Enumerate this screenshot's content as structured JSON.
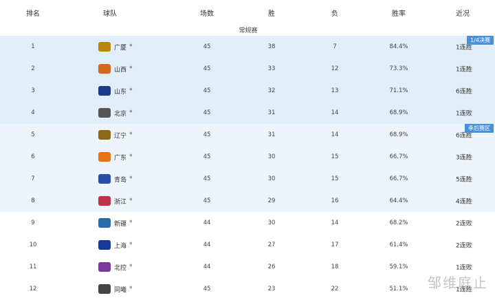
{
  "header": {
    "rank": "排名",
    "team": "球队",
    "games": "场数",
    "wins": "胜",
    "losses": "负",
    "pct": "胜率",
    "recent": "近况"
  },
  "section_label": "常规赛",
  "zone_labels": {
    "quarterfinal": "1/4决赛",
    "playoff": "季后赛区"
  },
  "watermark": "邹维庭止",
  "rows": [
    {
      "rank": "1",
      "team": "广厦",
      "star": "*",
      "games": "45",
      "wins": "38",
      "losses": "7",
      "pct": "84.4%",
      "recent": "1连胜",
      "logo_color": "#b8860b"
    },
    {
      "rank": "2",
      "team": "山西",
      "star": "*",
      "games": "45",
      "wins": "33",
      "losses": "12",
      "pct": "73.3%",
      "recent": "1连胜",
      "logo_color": "#d2691e"
    },
    {
      "rank": "3",
      "team": "山东",
      "star": "*",
      "games": "45",
      "wins": "32",
      "losses": "13",
      "pct": "71.1%",
      "recent": "6连胜",
      "logo_color": "#1e3a8a"
    },
    {
      "rank": "4",
      "team": "北京",
      "star": "*",
      "games": "45",
      "wins": "31",
      "losses": "14",
      "pct": "68.9%",
      "recent": "1连败",
      "logo_color": "#555555"
    },
    {
      "rank": "5",
      "team": "辽宁",
      "star": "*",
      "games": "45",
      "wins": "31",
      "losses": "14",
      "pct": "68.9%",
      "recent": "6连胜",
      "logo_color": "#8b6914"
    },
    {
      "rank": "6",
      "team": "广东",
      "star": "*",
      "games": "45",
      "wins": "30",
      "losses": "15",
      "pct": "66.7%",
      "recent": "3连胜",
      "logo_color": "#e8741a"
    },
    {
      "rank": "7",
      "team": "青岛",
      "star": "*",
      "games": "45",
      "wins": "30",
      "losses": "15",
      "pct": "66.7%",
      "recent": "5连胜",
      "logo_color": "#2850a8"
    },
    {
      "rank": "8",
      "team": "浙江",
      "star": "*",
      "games": "45",
      "wins": "29",
      "losses": "16",
      "pct": "64.4%",
      "recent": "4连胜",
      "logo_color": "#c0304a"
    },
    {
      "rank": "9",
      "team": "新疆",
      "star": "*",
      "games": "44",
      "wins": "30",
      "losses": "14",
      "pct": "68.2%",
      "recent": "2连败",
      "logo_color": "#2a6aa8"
    },
    {
      "rank": "10",
      "team": "上海",
      "star": "*",
      "games": "44",
      "wins": "27",
      "losses": "17",
      "pct": "61.4%",
      "recent": "2连败",
      "logo_color": "#1a3a9a"
    },
    {
      "rank": "11",
      "team": "北控",
      "star": "*",
      "games": "44",
      "wins": "26",
      "losses": "18",
      "pct": "59.1%",
      "recent": "1连败",
      "logo_color": "#7a3a9a"
    },
    {
      "rank": "12",
      "team": "同曦",
      "star": "*",
      "games": "45",
      "wins": "23",
      "losses": "22",
      "pct": "51.1%",
      "recent": "1连胜",
      "logo_color": "#444444"
    }
  ]
}
